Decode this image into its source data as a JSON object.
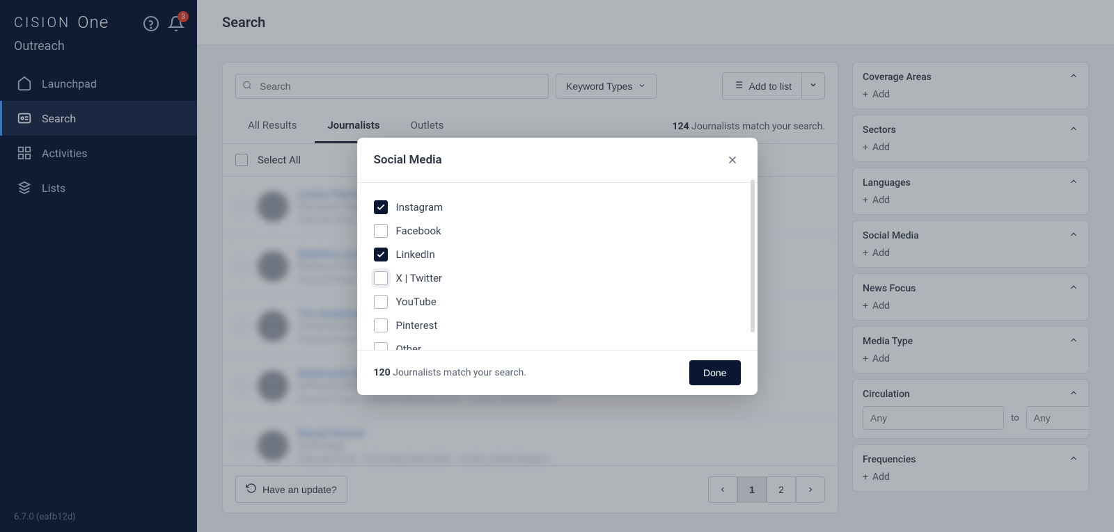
{
  "brand": {
    "name": "CISION",
    "product": "One",
    "section": "Outreach"
  },
  "header": {
    "notification_count": "3"
  },
  "sidebar": {
    "items": [
      {
        "label": "Launchpad",
        "icon": "home"
      },
      {
        "label": "Search",
        "icon": "search",
        "active": true
      },
      {
        "label": "Activities",
        "icon": "activities"
      },
      {
        "label": "Lists",
        "icon": "lists"
      }
    ]
  },
  "version": "6.7.0 (eafb12d)",
  "page": {
    "title": "Search"
  },
  "search": {
    "placeholder": "Search",
    "keyword_types_label": "Keyword Types",
    "add_to_list_label": "Add to list"
  },
  "tabs": [
    {
      "label": "All Results"
    },
    {
      "label": "Journalists",
      "active": true
    },
    {
      "label": "Outlets"
    }
  ],
  "results": {
    "count": "124",
    "count_suffix": "Journalists match your search.",
    "select_all": "Select All",
    "items": [
      {
        "name": "Louise Glamour Smith",
        "meta": "Education, Higher Education, Schools",
        "tags": "Financial Times · Education Editor"
      },
      {
        "name": "Matthew Lynn",
        "meta": "Banking, Economics, Politics, Asset Management",
        "tags": "Financial Times · Economics"
      },
      {
        "name": "Tim Bradshaw",
        "meta": "Computers & Laptops, E-Commerce",
        "tags": "Financial Times · Global Tech"
      },
      {
        "name": "Madhumita Murgia",
        "meta": "Artificial Intelligence (AI), Cyber Security, Technology",
        "tags": "Financial Times · Artificial Intelligence Editor · London, United Kingdom"
      },
      {
        "name": "Murad Ahmed",
        "meta": "Technology",
        "tags": "Financial Times · Technology News Editor · London, United Kingdom"
      }
    ]
  },
  "pagination": {
    "update_label": "Have an update?",
    "pages": [
      "1",
      "2"
    ]
  },
  "filters": [
    {
      "title": "Coverage Areas",
      "add": "Add"
    },
    {
      "title": "Sectors",
      "add": "Add"
    },
    {
      "title": "Languages",
      "add": "Add"
    },
    {
      "title": "Social Media",
      "add": "Add"
    },
    {
      "title": "News Focus",
      "add": "Add"
    },
    {
      "title": "Media Type",
      "add": "Add"
    },
    {
      "title": "Circulation",
      "type": "range",
      "placeholder_min": "Any",
      "placeholder_max": "Any",
      "to_label": "to"
    },
    {
      "title": "Frequencies",
      "add": "Add"
    }
  ],
  "modal": {
    "title": "Social Media",
    "options": [
      {
        "label": "Instagram",
        "checked": true
      },
      {
        "label": "Facebook",
        "checked": false
      },
      {
        "label": "LinkedIn",
        "checked": true
      },
      {
        "label": "X | Twitter",
        "checked": false,
        "hovered": true
      },
      {
        "label": "YouTube",
        "checked": false
      },
      {
        "label": "Pinterest",
        "checked": false
      },
      {
        "label": "Other",
        "checked": false
      }
    ],
    "footer_count": "120",
    "footer_suffix": "Journalists match your search.",
    "done_label": "Done"
  }
}
